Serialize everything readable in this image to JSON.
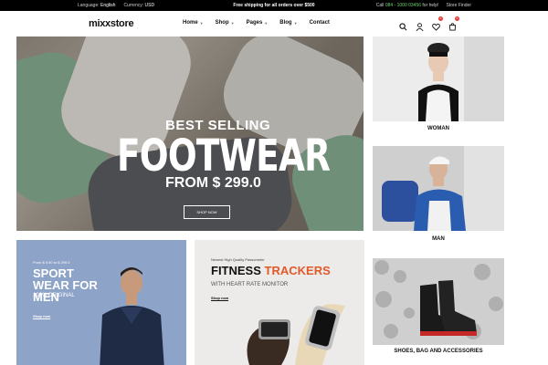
{
  "topbar": {
    "language_label": "Language:",
    "language_value": "English",
    "currency_label": "Currency:",
    "currency_value": "USD",
    "promo": "Free shipping for all orders over $500",
    "call_label": "Call",
    "call_number": "084 - 1000 03456",
    "call_suffix": "for help!",
    "store_finder": "Store Finder"
  },
  "header": {
    "logo": "mixxstore",
    "nav": [
      "Home",
      "Shop",
      "Pages",
      "Blog",
      "Contact"
    ],
    "icons": [
      "search-icon",
      "user-icon",
      "heart-icon",
      "cart-icon"
    ],
    "wishlist_count": "0",
    "cart_count": "0"
  },
  "hero": {
    "subtitle": "BEST SELLING",
    "title": "FOOTWEAR",
    "price": "FROM $ 299.0",
    "button": "SHOP NOW"
  },
  "tiles": {
    "woman": "WOMAN",
    "man": "MAN",
    "shoes": "SHOES, BAG AND ACCESSORIES"
  },
  "sport": {
    "small": "From $ 9.90 to $ 299.0",
    "title": "SPORT WEAR FOR MEN",
    "original": "100% ORIGINAL",
    "link": "Shop now"
  },
  "fitness": {
    "small": "Newest High Quality Passometer",
    "title_a": "FITNESS",
    "title_b": "TRACKERS",
    "subtitle": "WITH HEART RATE MONITOR",
    "link": "Shop now"
  },
  "colors": {
    "accent": "#e05a2a",
    "topbar": "#000000",
    "badge": "#e53935"
  }
}
